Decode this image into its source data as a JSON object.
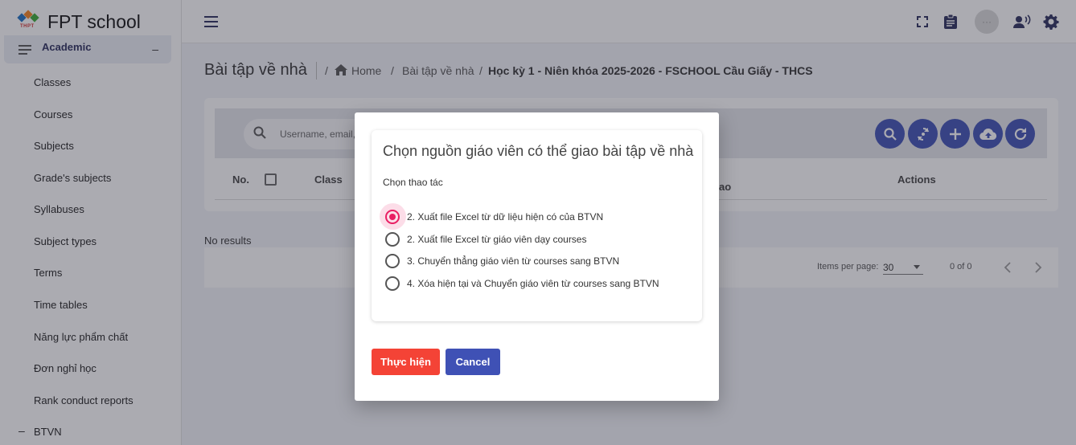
{
  "app": {
    "name": "FPT school",
    "logo_tag": "THPT"
  },
  "sidebar": {
    "section": {
      "label": "Academic",
      "toggle": "–"
    },
    "items": [
      {
        "label": "Classes"
      },
      {
        "label": "Courses"
      },
      {
        "label": "Subjects"
      },
      {
        "label": "Grade's subjects"
      },
      {
        "label": "Syllabuses"
      },
      {
        "label": "Subject types"
      },
      {
        "label": "Terms"
      },
      {
        "label": "Time tables"
      },
      {
        "label": "Năng lực phẩm chất"
      },
      {
        "label": "Đơn nghỉ học"
      },
      {
        "label": "Rank conduct reports"
      },
      {
        "label": "BTVN",
        "toggle": "–"
      }
    ]
  },
  "topbar": {
    "icons": [
      "menu-icon",
      "fullscreen-icon",
      "clipboard-icon",
      "avatar",
      "voice-icon",
      "gear-icon"
    ],
    "avatar_text": "···"
  },
  "page": {
    "title": "Bài tập về nhà",
    "breadcrumb": {
      "sep1": "/",
      "home": "Home",
      "sep2": "/",
      "section": "Bài tập về nhà",
      "sep3": "/",
      "current": "Học kỳ 1 - Niên khóa 2025-2026 - FSCHOOL Cầu Giấy - THCS"
    },
    "search": {
      "placeholder": "Username, email, tê"
    },
    "toolbar_icons": [
      "search-icon",
      "sync-icon",
      "add-icon",
      "upload-icon",
      "refresh-icon"
    ],
    "table": {
      "columns": [
        "No.",
        "Class",
        "ao",
        "Actions"
      ]
    },
    "no_results": "No results",
    "paginator": {
      "items_per_page_label": "Items per page:",
      "items_per_page": "30",
      "range": "0 of 0"
    }
  },
  "modal": {
    "title": "Chọn nguồn giáo viên có thể giao bài tập về nhà",
    "subtitle": "Chọn thao tác",
    "options": [
      {
        "label": "2. Xuất file Excel từ dữ liệu hiện có của BTVN",
        "checked": true
      },
      {
        "label": "2. Xuất file Excel từ giáo viên dạy courses",
        "checked": false
      },
      {
        "label": "3. Chuyển thẳng giáo viên từ courses sang BTVN",
        "checked": false
      },
      {
        "label": "4. Xóa hiện tại và Chuyển giáo viên từ courses sang BTVN",
        "checked": false
      }
    ],
    "run_button": "Thực hiện",
    "cancel_button": "Cancel"
  },
  "colors": {
    "primary": "#3f51b5",
    "accent": "#e91e63",
    "danger": "#f44336",
    "nav_text": "#2b2d5c"
  }
}
